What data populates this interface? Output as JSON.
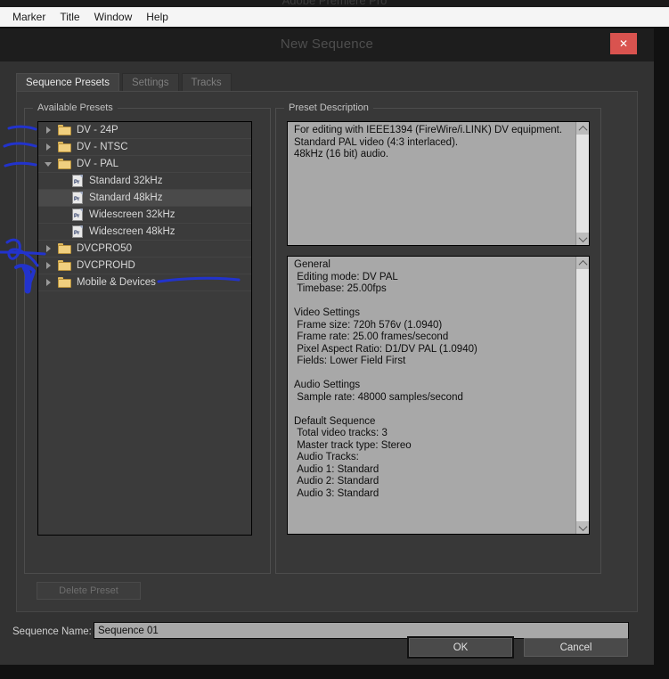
{
  "app": {
    "title_partial": "Adobe Premiere Pro"
  },
  "menubar": {
    "items": [
      {
        "label": "Marker"
      },
      {
        "label": "Title"
      },
      {
        "label": "Window"
      },
      {
        "label": "Help"
      }
    ]
  },
  "dialog": {
    "title": "New Sequence",
    "close_label": "✕",
    "tabs": [
      {
        "label": "Sequence Presets",
        "active": true
      },
      {
        "label": "Settings",
        "active": false
      },
      {
        "label": "Tracks",
        "active": false
      }
    ],
    "presets_group": {
      "label": "Available Presets",
      "tree": [
        {
          "label": "DV - 24P",
          "type": "folder",
          "state": "collapsed",
          "level": 0,
          "selected": false
        },
        {
          "label": "DV - NTSC",
          "type": "folder",
          "state": "collapsed",
          "level": 0,
          "selected": false
        },
        {
          "label": "DV - PAL",
          "type": "folder",
          "state": "expanded",
          "level": 0,
          "selected": false
        },
        {
          "label": "Standard 32kHz",
          "type": "preset",
          "state": "none",
          "level": 1,
          "selected": false
        },
        {
          "label": "Standard 48kHz",
          "type": "preset",
          "state": "none",
          "level": 1,
          "selected": true
        },
        {
          "label": "Widescreen 32kHz",
          "type": "preset",
          "state": "none",
          "level": 1,
          "selected": false
        },
        {
          "label": "Widescreen 48kHz",
          "type": "preset",
          "state": "none",
          "level": 1,
          "selected": false
        },
        {
          "label": "DVCPRO50",
          "type": "folder",
          "state": "collapsed",
          "level": 0,
          "selected": false
        },
        {
          "label": "DVCPROHD",
          "type": "folder",
          "state": "collapsed",
          "level": 0,
          "selected": false
        },
        {
          "label": "Mobile & Devices",
          "type": "folder",
          "state": "collapsed",
          "level": 0,
          "selected": false
        }
      ],
      "delete_preset_label": "Delete Preset"
    },
    "description_group": {
      "label": "Preset Description",
      "summary": "For editing with IEEE1394 (FireWire/i.LINK) DV equipment.\nStandard PAL video (4:3 interlaced).\n48kHz (16 bit) audio.",
      "details": "General\n Editing mode: DV PAL\n Timebase: 25.00fps\n\nVideo Settings\n Frame size: 720h 576v (1.0940)\n Frame rate: 25.00 frames/second\n Pixel Aspect Ratio: D1/DV PAL (1.0940)\n Fields: Lower Field First\n\nAudio Settings\n Sample rate: 48000 samples/second\n\nDefault Sequence\n Total video tracks: 3\n Master track type: Stereo\n Audio Tracks:\n Audio 1: Standard\n Audio 2: Standard\n Audio 3: Standard"
    },
    "sequence_name": {
      "label": "Sequence Name:",
      "value": "Sequence 01"
    },
    "footer": {
      "ok_label": "OK",
      "cancel_label": "Cancel"
    }
  },
  "colors": {
    "dialog_bg": "#323232",
    "panel_bg": "#383838",
    "tree_bg": "#3b3b3b",
    "description_bg": "#a8a8a8",
    "close_red": "#d9534f",
    "folder_yellow": "#f0cf7f",
    "annotation_blue": "#2233cc"
  }
}
